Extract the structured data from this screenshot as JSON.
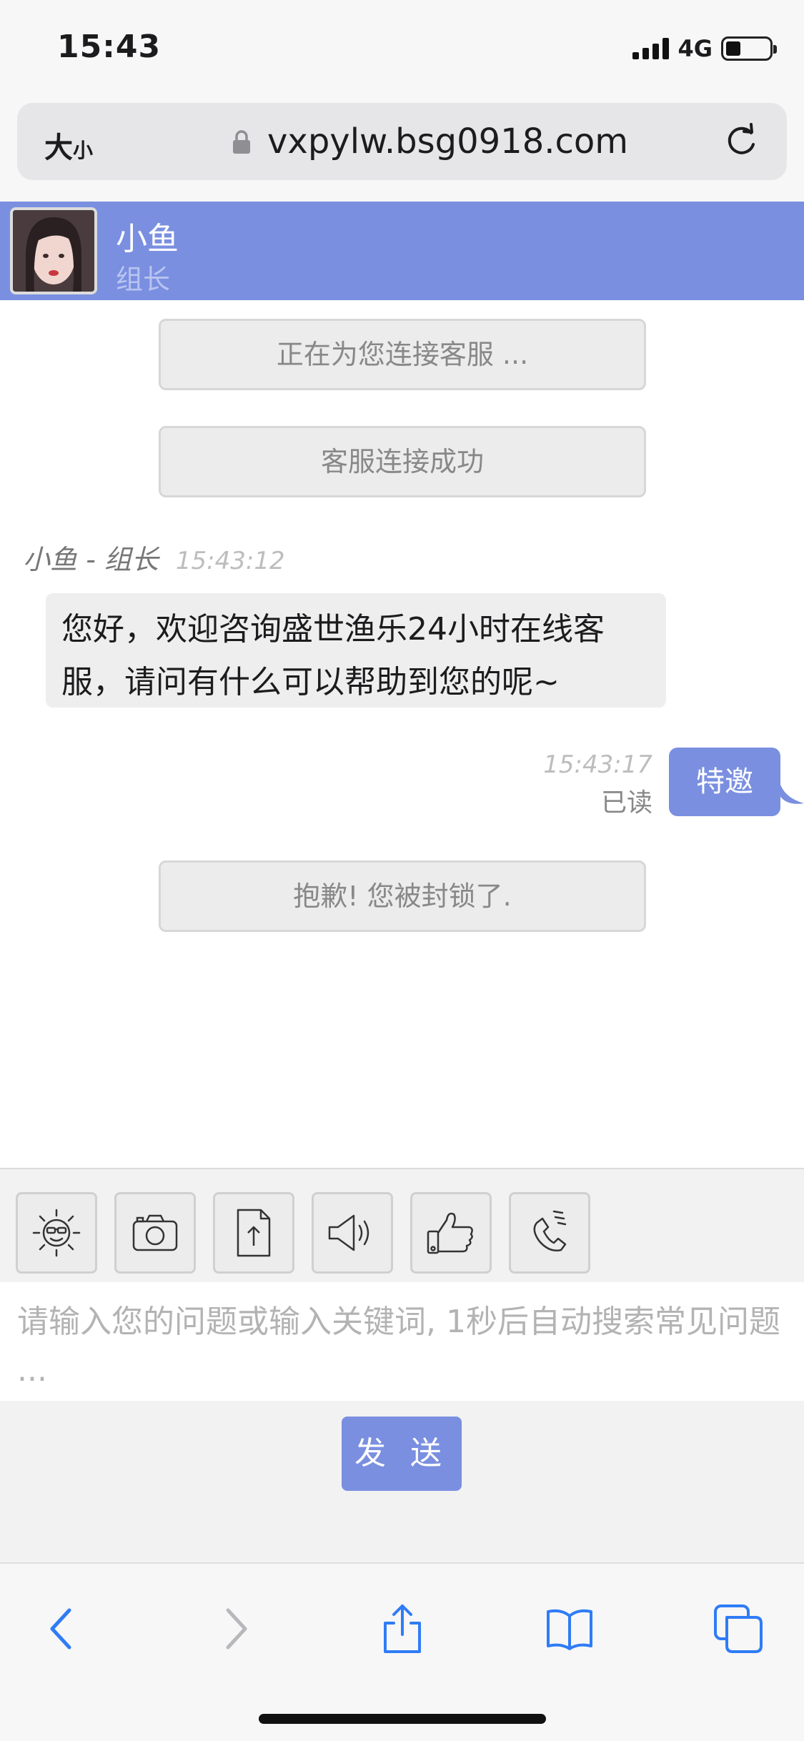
{
  "status_bar": {
    "time": "15:43",
    "network": "4G",
    "battery_level": 0.34
  },
  "browser": {
    "text_size_label_large": "大",
    "text_size_label_small": "小",
    "url": "vxpylw.bsg0918.com"
  },
  "chat_header": {
    "agent_name": "小鱼",
    "agent_role": "组长"
  },
  "messages": {
    "notice_connecting": "正在为您连接客服 ...",
    "notice_connected": "客服连接成功",
    "incoming_sender": "小鱼 - 组长",
    "incoming_time": "15:43:12",
    "incoming_text": "您好，欢迎咨询盛世渔乐24小时在线客服，请问有什么可以帮助到您的呢~",
    "outgoing_time": "15:43:17",
    "outgoing_status": "已读",
    "outgoing_text": "特邀",
    "notice_blocked": "抱歉! 您被封锁了."
  },
  "toolbar": {
    "icons": [
      "emoji-icon",
      "camera-icon",
      "file-upload-icon",
      "voice-icon",
      "thumbs-up-icon",
      "phone-icon"
    ]
  },
  "input": {
    "placeholder": "请输入您的问题或输入关键词, 1秒后自动搜索常见问题 ..."
  },
  "send": {
    "label": "发 送"
  },
  "colors": {
    "accent": "#7a8fe0",
    "browser_blue": "#2f7cf6"
  }
}
